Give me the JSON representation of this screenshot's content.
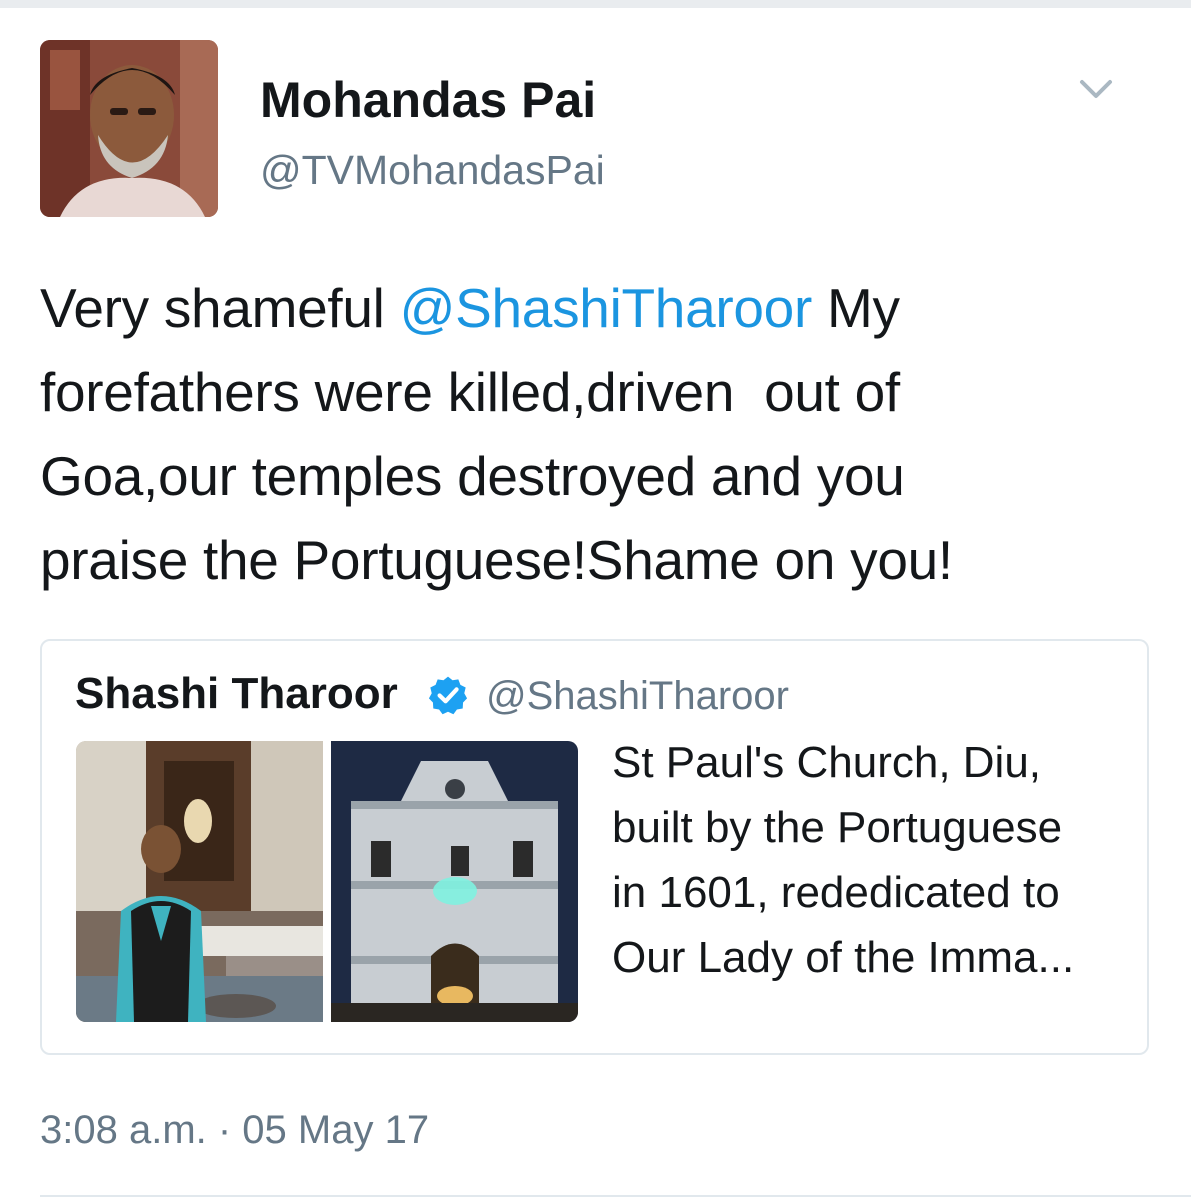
{
  "tweet": {
    "author": {
      "display_name": "Mohandas Pai",
      "handle": "@TVMohandasPai",
      "avatar_icon": "profile-photo"
    },
    "menu_icon": "chevron-down-icon",
    "text_lines": [
      {
        "pre": "Very shameful ",
        "mention": "@ShashiTharoor",
        "post": " My"
      },
      "forefathers were killed,driven  out of",
      "Goa,our temples destroyed and you",
      "praise the Portuguese!Shame on you!"
    ],
    "timestamp": "3:08 a.m. · 05 May 17",
    "colors": {
      "mention": "#1b95e0",
      "secondary_text": "#657786",
      "verified": "#1da1f2"
    }
  },
  "quoted_tweet": {
    "display_name": "Shashi Tharoor",
    "verified_icon": "verified-badge-icon",
    "handle": "@ShashiTharoor",
    "text_lines": [
      "St Paul's Church, Diu,",
      "built by the Portuguese",
      "in 1601, rededicated to",
      "Our Lady of the Imma..."
    ],
    "photos": [
      "man-in-church-photo",
      "church-facade-night-photo"
    ]
  }
}
